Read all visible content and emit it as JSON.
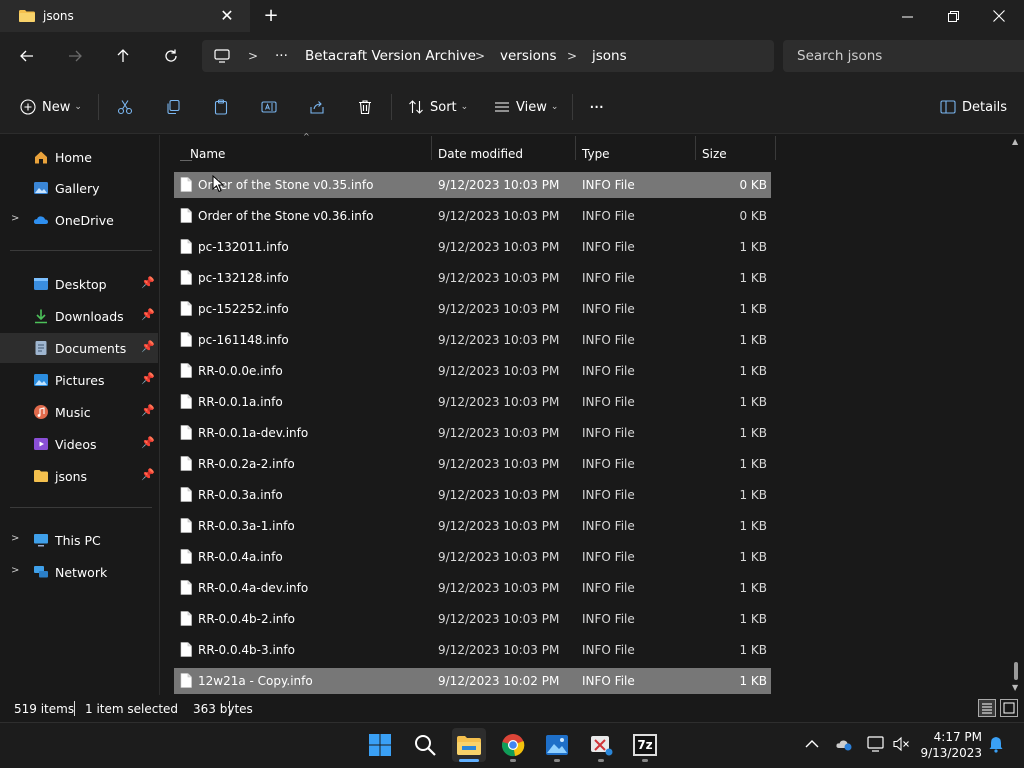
{
  "window": {
    "tab_title": "jsons",
    "new_tab": "+",
    "tab_close": "✕"
  },
  "address": {
    "ellipsis": "···",
    "crumbs": [
      "Betacraft Version Archive",
      "versions",
      "jsons"
    ],
    "search_placeholder": "Search jsons"
  },
  "toolbar": {
    "new_label": "New",
    "sort_label": "Sort",
    "view_label": "View",
    "more_label": "···",
    "details_label": "Details"
  },
  "sidebar": {
    "items": [
      {
        "label": "Home"
      },
      {
        "label": "Gallery"
      },
      {
        "label": "OneDrive"
      },
      {
        "label": "Desktop"
      },
      {
        "label": "Downloads"
      },
      {
        "label": "Documents"
      },
      {
        "label": "Pictures"
      },
      {
        "label": "Music"
      },
      {
        "label": "Videos"
      },
      {
        "label": "jsons"
      },
      {
        "label": "This PC"
      },
      {
        "label": "Network"
      }
    ]
  },
  "columns": {
    "name": "Name",
    "date": "Date modified",
    "type": "Type",
    "size": "Size"
  },
  "files": [
    {
      "name": "Order of the Stone v0.35.info",
      "date": "9/12/2023 10:03 PM",
      "type": "INFO File",
      "size": "0 KB"
    },
    {
      "name": "Order of the Stone v0.36.info",
      "date": "9/12/2023 10:03 PM",
      "type": "INFO File",
      "size": "0 KB"
    },
    {
      "name": "pc-132011.info",
      "date": "9/12/2023 10:03 PM",
      "type": "INFO File",
      "size": "1 KB"
    },
    {
      "name": "pc-132128.info",
      "date": "9/12/2023 10:03 PM",
      "type": "INFO File",
      "size": "1 KB"
    },
    {
      "name": "pc-152252.info",
      "date": "9/12/2023 10:03 PM",
      "type": "INFO File",
      "size": "1 KB"
    },
    {
      "name": "pc-161148.info",
      "date": "9/12/2023 10:03 PM",
      "type": "INFO File",
      "size": "1 KB"
    },
    {
      "name": "RR-0.0.0e.info",
      "date": "9/12/2023 10:03 PM",
      "type": "INFO File",
      "size": "1 KB"
    },
    {
      "name": "RR-0.0.1a.info",
      "date": "9/12/2023 10:03 PM",
      "type": "INFO File",
      "size": "1 KB"
    },
    {
      "name": "RR-0.0.1a-dev.info",
      "date": "9/12/2023 10:03 PM",
      "type": "INFO File",
      "size": "1 KB"
    },
    {
      "name": "RR-0.0.2a-2.info",
      "date": "9/12/2023 10:03 PM",
      "type": "INFO File",
      "size": "1 KB"
    },
    {
      "name": "RR-0.0.3a.info",
      "date": "9/12/2023 10:03 PM",
      "type": "INFO File",
      "size": "1 KB"
    },
    {
      "name": "RR-0.0.3a-1.info",
      "date": "9/12/2023 10:03 PM",
      "type": "INFO File",
      "size": "1 KB"
    },
    {
      "name": "RR-0.0.4a.info",
      "date": "9/12/2023 10:03 PM",
      "type": "INFO File",
      "size": "1 KB"
    },
    {
      "name": "RR-0.0.4a-dev.info",
      "date": "9/12/2023 10:03 PM",
      "type": "INFO File",
      "size": "1 KB"
    },
    {
      "name": "RR-0.0.4b-2.info",
      "date": "9/12/2023 10:03 PM",
      "type": "INFO File",
      "size": "1 KB"
    },
    {
      "name": "RR-0.0.4b-3.info",
      "date": "9/12/2023 10:03 PM",
      "type": "INFO File",
      "size": "1 KB"
    },
    {
      "name": "12w21a - Copy.info",
      "date": "9/12/2023 10:02 PM",
      "type": "INFO File",
      "size": "1 KB"
    }
  ],
  "status": {
    "item_count": "519 items",
    "selection": "1 item selected",
    "selection_size": "363 bytes"
  },
  "taskbar": {
    "time": "4:17 PM",
    "date": "9/13/2023",
    "sevenzip_label": "7z"
  },
  "colors": {
    "accent": "#0078d4",
    "selected_row": "#777777",
    "folder": "#f4c04e"
  }
}
